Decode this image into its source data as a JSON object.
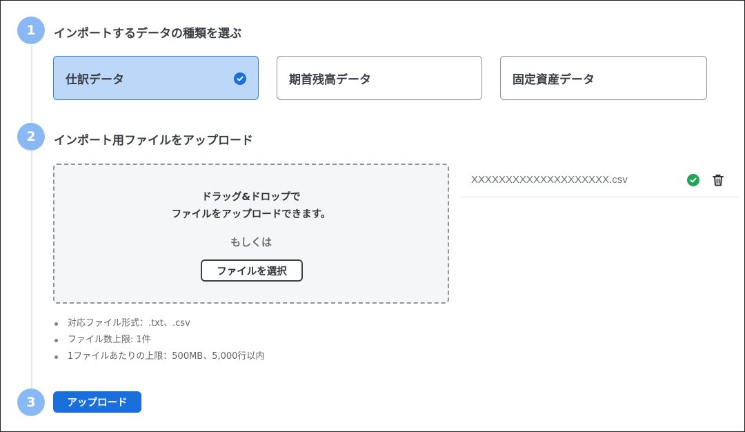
{
  "steps": [
    {
      "number": "1",
      "title": "インポートするデータの種類を選ぶ"
    },
    {
      "number": "2",
      "title": "インポート用ファイルをアップロード"
    },
    {
      "number": "3"
    }
  ],
  "data_types": [
    {
      "label": "仕訳データ",
      "selected": true
    },
    {
      "label": "期首残高データ",
      "selected": false
    },
    {
      "label": "固定資産データ",
      "selected": false
    }
  ],
  "dropzone": {
    "line1": "ドラッグ&ドロップで",
    "line2": "ファイルをアップロードできます。",
    "or": "もしくは",
    "select_button": "ファイルを選択"
  },
  "uploaded_file": {
    "name": "XXXXXXXXXXXXXXXXXXXX.csv",
    "status_icon": "check-circle-icon",
    "delete_icon": "trash-icon"
  },
  "notes": [
    "対応ファイル形式：.txt、.csv",
    "ファイル数上限: 1件",
    "1ファイルあたりの上限：500MB、5,000行以内"
  ],
  "upload_button": "アップロード",
  "colors": {
    "accent": "#1a6fdc",
    "step_circle": "#8ab8f5",
    "selected_card_bg": "#bcd7f8",
    "success": "#1fa45a"
  }
}
